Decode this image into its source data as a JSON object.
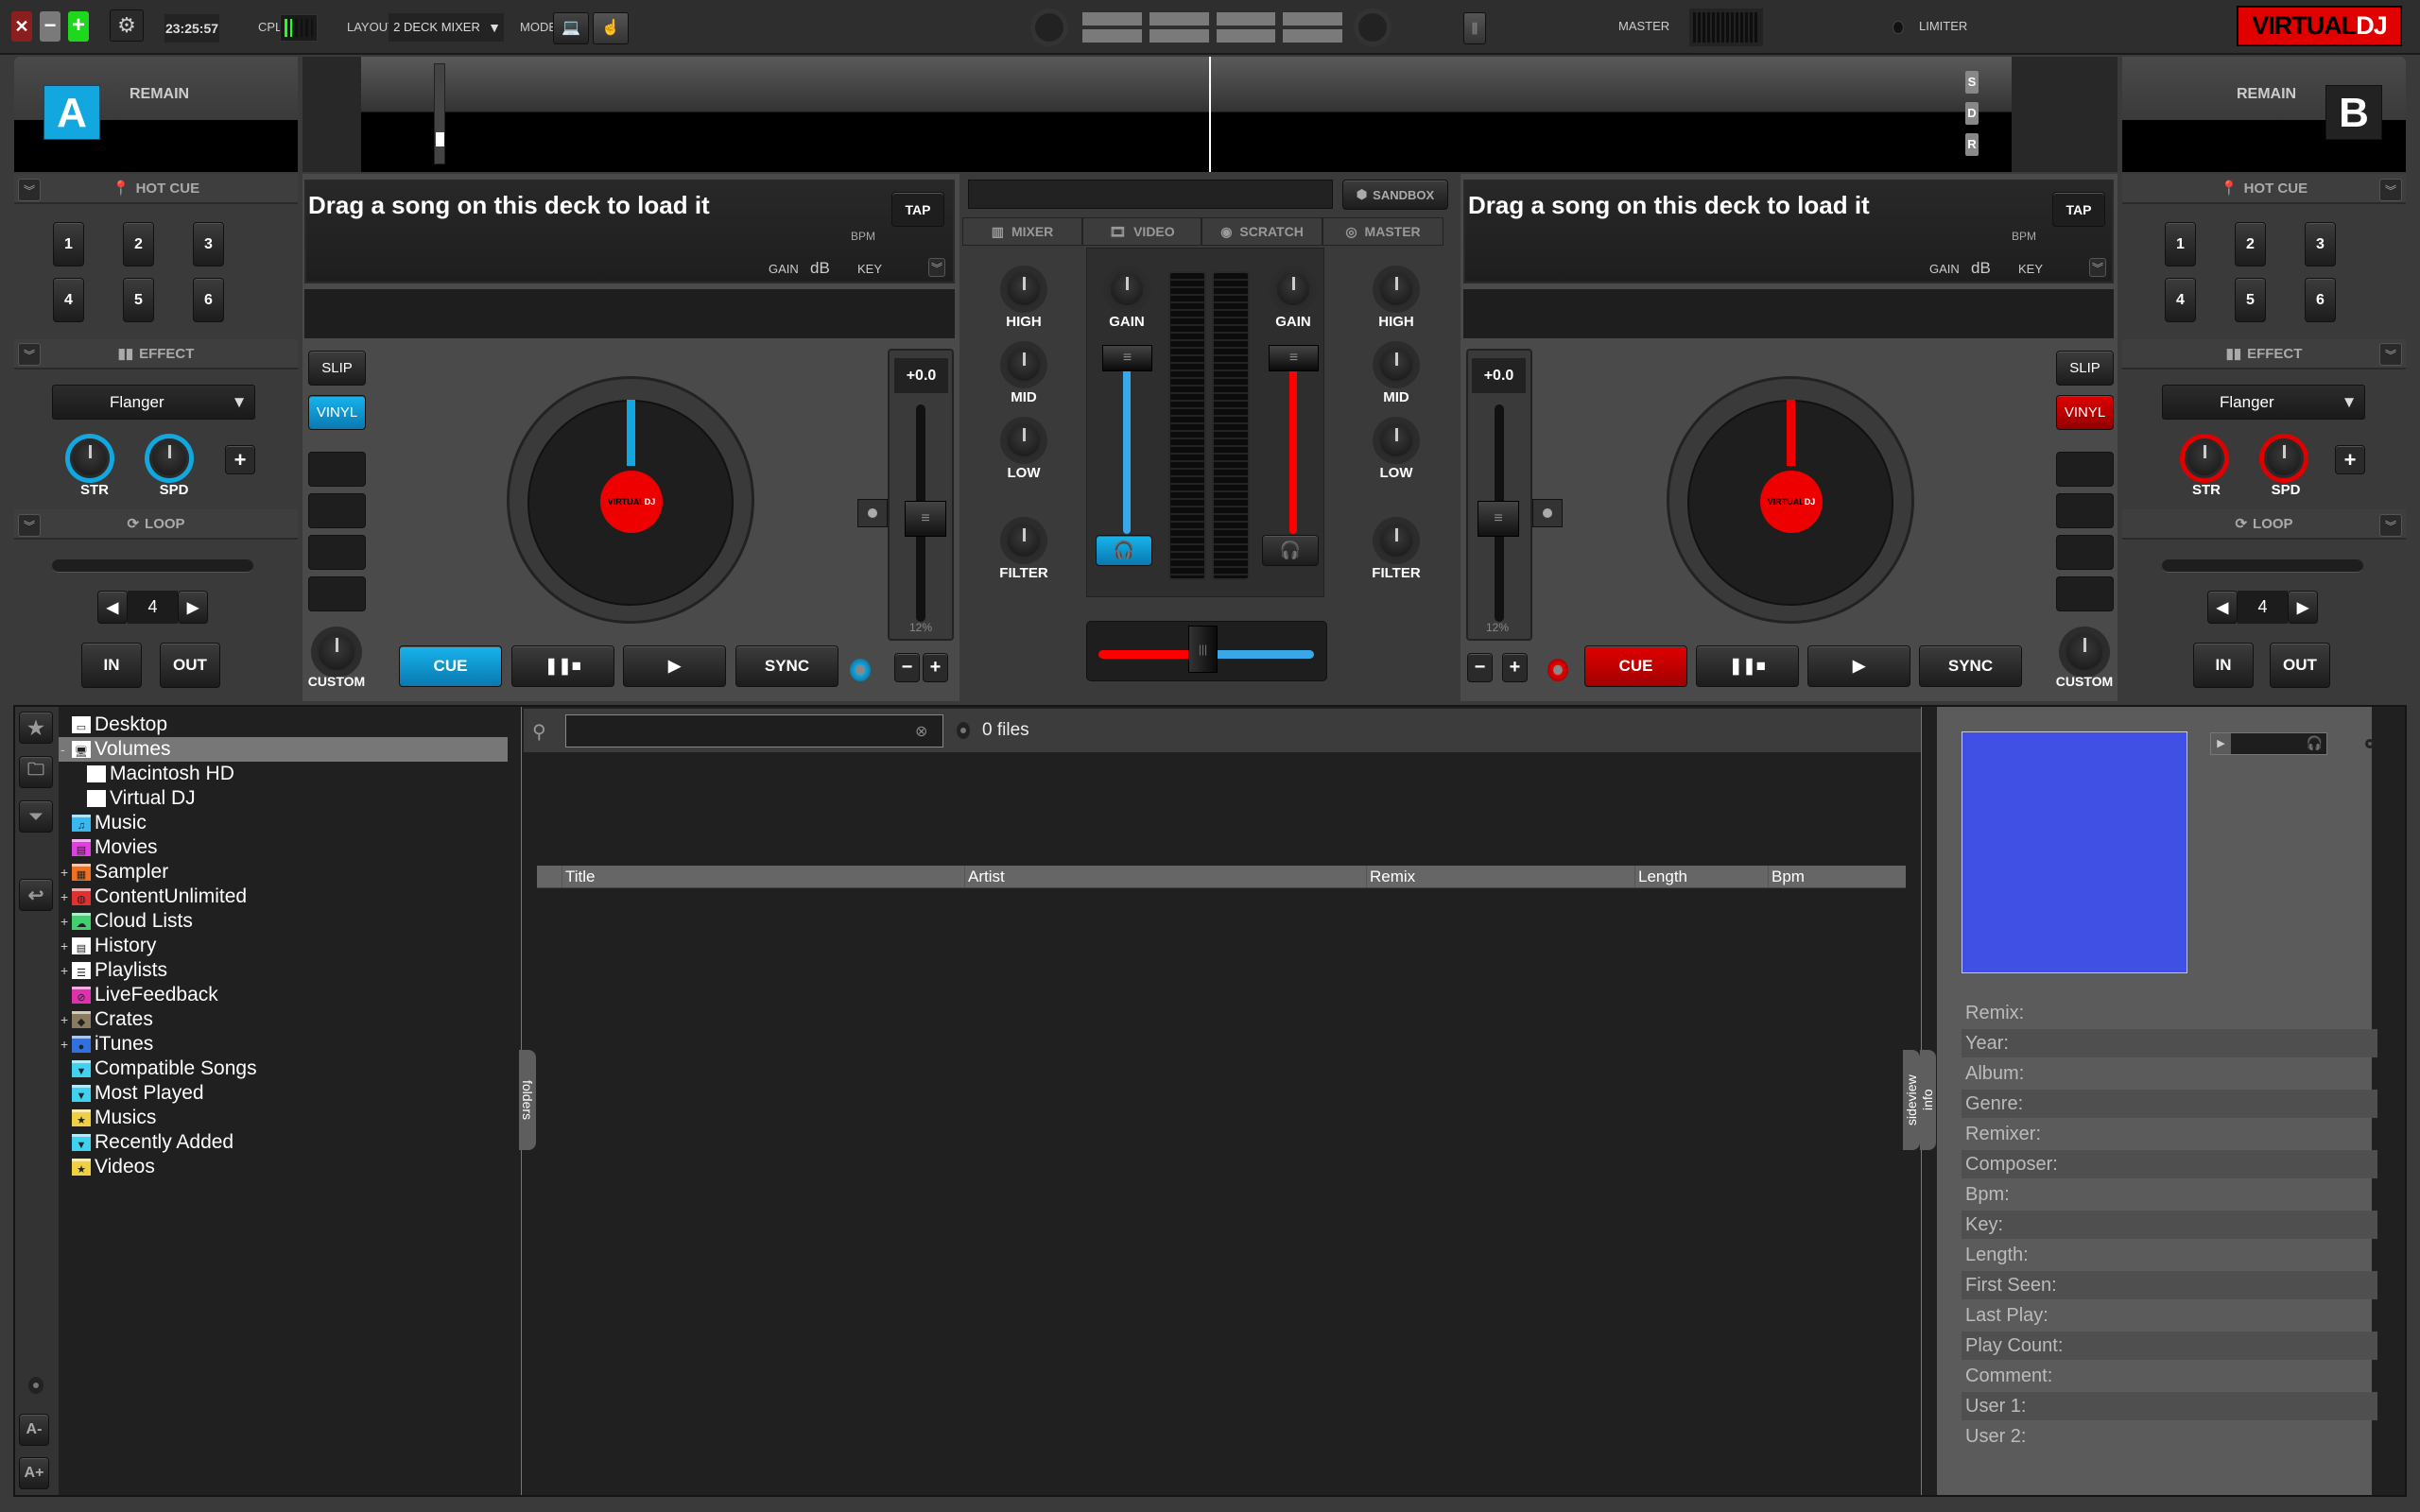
{
  "topbar": {
    "close_icon": "close-icon",
    "minimize_icon": "minimize-icon",
    "maximize_icon": "maximize-icon",
    "settings_icon": "gear-icon",
    "clock": "23:25:57",
    "cpu_label": "CPL",
    "layout_label": "LAYOUT",
    "layout_value": "2 DECK MIXER",
    "mode_label": "MODE",
    "master_label": "MASTER",
    "limiter_label": "LIMITER",
    "logo_virtual": "VIRTUAL",
    "logo_dj": "DJ",
    "colors": {
      "close": "#8b1e1e",
      "maximize": "#1ed81e",
      "logo_bg": "#e00000"
    }
  },
  "deck_a": {
    "letter": "A",
    "remain_label": "REMAIN",
    "color": "#13a7e0",
    "title_placeholder": "Drag a song on this deck to load it",
    "tap": "TAP",
    "bpm_label": "BPM",
    "gain_label": "GAIN",
    "gain_unit": "dB",
    "key_label": "KEY",
    "slip": "SLIP",
    "vinyl": "VINYL",
    "custom": "CUSTOM",
    "pitch_value": "+0.0",
    "pitch_range": "12%",
    "cue": "CUE",
    "sync": "SYNC",
    "platter_logo_virtual": "VIRTUAL",
    "platter_logo_dj": "DJ",
    "hot_cue_title": "HOT CUE",
    "hot_cues": [
      "1",
      "2",
      "3",
      "4",
      "5",
      "6"
    ],
    "effect_title": "EFFECT",
    "effect_value": "Flanger",
    "effect_knobs": [
      "STR",
      "SPD"
    ],
    "loop_title": "LOOP",
    "loop_size": "4",
    "loop_in": "IN",
    "loop_out": "OUT"
  },
  "deck_b": {
    "letter": "B",
    "remain_label": "REMAIN",
    "color": "#e00000",
    "title_placeholder": "Drag a song on this deck to load it",
    "tap": "TAP",
    "bpm_label": "BPM",
    "gain_label": "GAIN",
    "gain_unit": "dB",
    "key_label": "KEY",
    "slip": "SLIP",
    "vinyl": "VINYL",
    "custom": "CUSTOM",
    "pitch_value": "+0.0",
    "pitch_range": "12%",
    "cue": "CUE",
    "sync": "SYNC",
    "platter_logo_virtual": "VIRTUAL",
    "platter_logo_dj": "DJ",
    "hot_cue_title": "HOT CUE",
    "hot_cues": [
      "1",
      "2",
      "3",
      "4",
      "5",
      "6"
    ],
    "effect_title": "EFFECT",
    "effect_value": "Flanger",
    "effect_knobs": [
      "STR",
      "SPD"
    ],
    "loop_title": "LOOP",
    "loop_size": "4",
    "loop_in": "IN",
    "loop_out": "OUT"
  },
  "waveform": {
    "sdr": [
      "S",
      "D",
      "R"
    ]
  },
  "mixer": {
    "sandbox": "SANDBOX",
    "tabs": [
      "MIXER",
      "VIDEO",
      "SCRATCH",
      "MASTER"
    ],
    "eq_left": [
      "HIGH",
      "MID",
      "LOW",
      "FILTER"
    ],
    "eq_right": [
      "HIGH",
      "MID",
      "LOW",
      "FILTER"
    ],
    "gain": "GAIN",
    "crossfader_position": 0.5
  },
  "browser": {
    "sidebar_tools": [
      "favorite-folder-add-icon",
      "folder-add-icon",
      "filter-add-icon",
      "back-icon"
    ],
    "font_buttons": [
      "A-",
      "A+"
    ],
    "tree": [
      {
        "label": "Desktop",
        "icon": "desktop-icon",
        "color": "#ffffff",
        "expander": "",
        "indent": 0
      },
      {
        "label": "Volumes",
        "icon": "computer-icon",
        "color": "#ffffff",
        "expander": "-",
        "indent": 0,
        "selected": true
      },
      {
        "label": "Macintosh HD",
        "icon": "folder-icon",
        "color": "#ffffff",
        "expander": "",
        "indent": 1
      },
      {
        "label": "Virtual DJ",
        "icon": "folder-icon",
        "color": "#ffffff",
        "expander": "",
        "indent": 1
      },
      {
        "label": "Music",
        "icon": "music-note-icon",
        "color": "#38b8f0",
        "expander": "",
        "indent": 0
      },
      {
        "label": "Movies",
        "icon": "film-icon",
        "color": "#e040e0",
        "expander": "",
        "indent": 0
      },
      {
        "label": "Sampler",
        "icon": "grid-icon",
        "color": "#f07020",
        "expander": "+",
        "indent": 0
      },
      {
        "label": "ContentUnlimited",
        "icon": "globe-icon",
        "color": "#e03030",
        "expander": "+",
        "indent": 0
      },
      {
        "label": "Cloud Lists",
        "icon": "cloud-icon",
        "color": "#40d070",
        "expander": "+",
        "indent": 0
      },
      {
        "label": "History",
        "icon": "calendar-icon",
        "color": "#ffffff",
        "expander": "+",
        "indent": 0
      },
      {
        "label": "Playlists",
        "icon": "list-icon",
        "color": "#ffffff",
        "expander": "+",
        "indent": 0
      },
      {
        "label": "LiveFeedback",
        "icon": "feedback-icon",
        "color": "#e030b0",
        "expander": "",
        "indent": 0
      },
      {
        "label": "Crates",
        "icon": "crate-icon",
        "color": "#8a7a60",
        "expander": "+",
        "indent": 0
      },
      {
        "label": "iTunes",
        "icon": "apple-icon",
        "color": "#3070e0",
        "expander": "+",
        "indent": 0
      },
      {
        "label": "Compatible Songs",
        "icon": "filter-icon",
        "color": "#40d0f0",
        "expander": "",
        "indent": 0
      },
      {
        "label": "Most Played",
        "icon": "filter-icon",
        "color": "#40d0f0",
        "expander": "",
        "indent": 0
      },
      {
        "label": "Musics",
        "icon": "star-icon",
        "color": "#f0d040",
        "expander": "",
        "indent": 0
      },
      {
        "label": "Recently Added",
        "icon": "filter-icon",
        "color": "#40d0f0",
        "expander": "",
        "indent": 0
      },
      {
        "label": "Videos",
        "icon": "star-icon",
        "color": "#f0d040",
        "expander": "",
        "indent": 0
      }
    ],
    "folders_tab": "folders",
    "search_value": "",
    "files_count": "0 files",
    "columns": [
      "Title",
      "Artist",
      "Remix",
      "Length",
      "Bpm"
    ],
    "sideview_tabs": [
      "sideview",
      "info"
    ],
    "cover_color": "#4150e4",
    "info_fields": [
      "Remix:",
      "Year:",
      "Album:",
      "Genre:",
      "Remixer:",
      "Composer:",
      "Bpm:",
      "Key:",
      "Length:",
      "First Seen:",
      "Last Play:",
      "Play Count:",
      "Comment:",
      "User 1:",
      "User 2:"
    ]
  }
}
